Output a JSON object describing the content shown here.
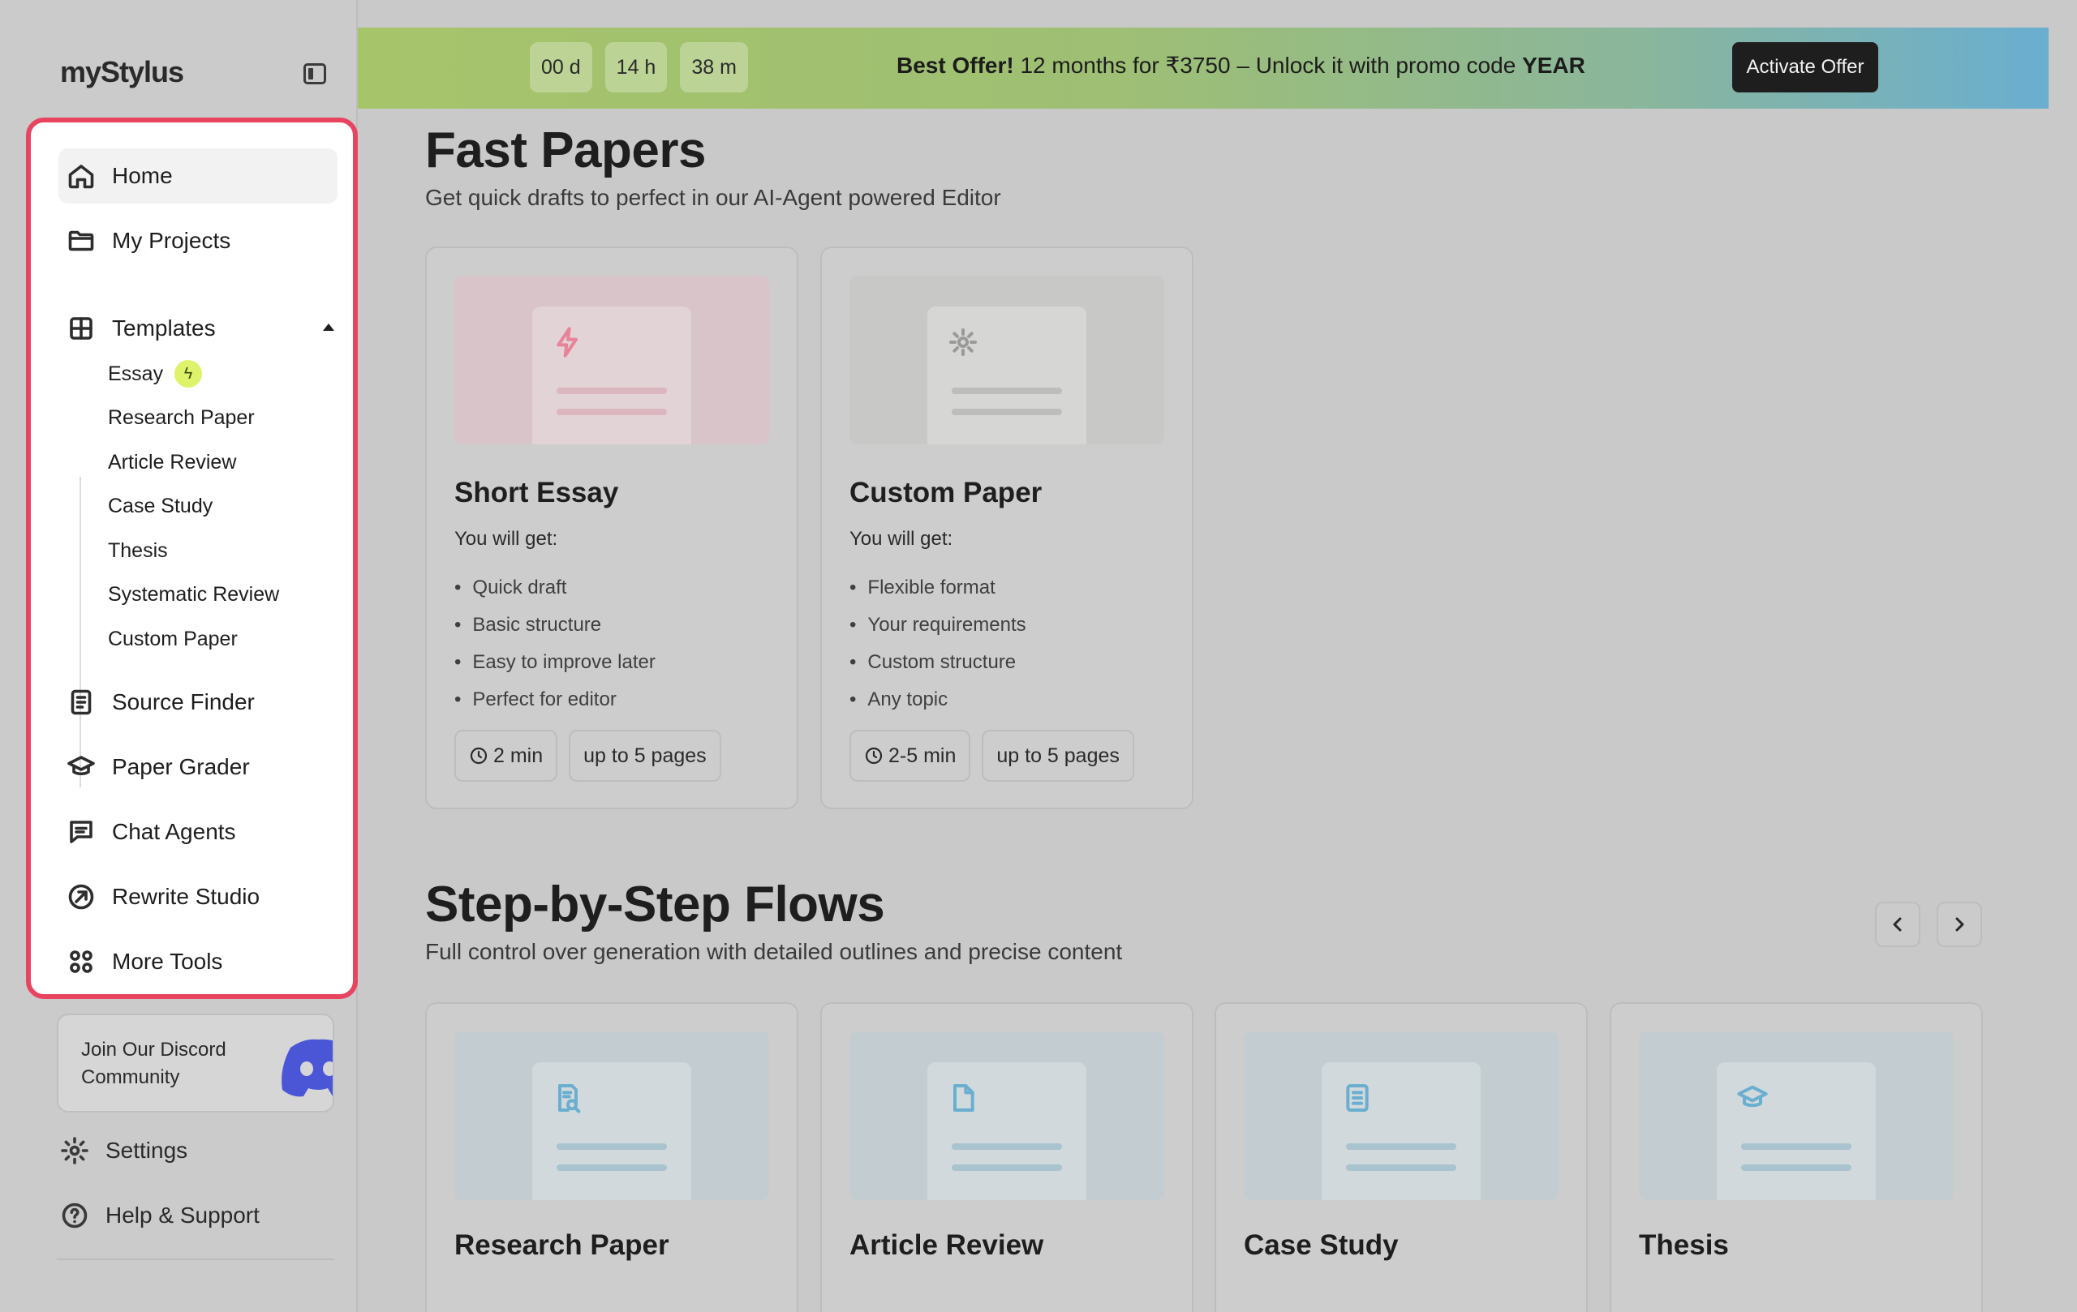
{
  "app": {
    "logo": "myStylus"
  },
  "sidebar": {
    "nav": [
      {
        "label": "Home",
        "icon": "home-icon"
      },
      {
        "label": "My Projects",
        "icon": "folder-icon"
      },
      {
        "label": "Templates",
        "icon": "grid-icon"
      }
    ],
    "templates": [
      "Essay",
      "Research Paper",
      "Article Review",
      "Case Study",
      "Thesis",
      "Systematic Review",
      "Custom Paper"
    ],
    "tools": [
      {
        "label": "Source Finder",
        "icon": "document-icon"
      },
      {
        "label": "Paper Grader",
        "icon": "graduation-cap-icon"
      },
      {
        "label": "Chat Agents",
        "icon": "chat-icon"
      },
      {
        "label": "Rewrite Studio",
        "icon": "rewrite-icon"
      },
      {
        "label": "More Tools",
        "icon": "apps-icon"
      }
    ],
    "discord": {
      "text": "Join Our Discord Community",
      "icon": "discord-icon"
    },
    "settings": "Settings",
    "help": "Help & Support"
  },
  "banner": {
    "countdown": [
      "00 d",
      "14 h",
      "38 m"
    ],
    "offer_bold": "Best Offer!",
    "offer_text": "12 months for ₹3750 – Unlock it with promo code",
    "promo_code": "YEAR",
    "cta": "Activate Offer"
  },
  "fast_papers": {
    "title": "Fast Papers",
    "subtitle": "Get quick drafts to perfect in our AI-Agent powered Editor",
    "cards": [
      {
        "title": "Short Essay",
        "label": "You will get:",
        "items": [
          "Quick draft",
          "Basic structure",
          "Easy to improve later",
          "Perfect for editor"
        ],
        "time": "2 min",
        "pages": "up to 5 pages",
        "icon": "lightning-icon",
        "accent": "#e8839a"
      },
      {
        "title": "Custom Paper",
        "label": "You will get:",
        "items": [
          "Flexible format",
          "Your requirements",
          "Custom structure",
          "Any topic"
        ],
        "time": "2-5 min",
        "pages": "up to 5 pages",
        "icon": "gear-icon",
        "accent": "#9a9a9a"
      }
    ]
  },
  "flows": {
    "title": "Step-by-Step Flows",
    "subtitle": "Full control over generation with detailed outlines and precise content",
    "cards": [
      {
        "title": "Research Paper",
        "icon": "search-document-icon"
      },
      {
        "title": "Article Review",
        "icon": "file-icon"
      },
      {
        "title": "Case Study",
        "icon": "list-document-icon"
      },
      {
        "title": "Thesis",
        "icon": "graduation-cap-icon"
      }
    ]
  },
  "colors": {
    "highlight_border": "#e8445f",
    "flow_accent": "#6aaed0",
    "badge": "#dff36a"
  }
}
